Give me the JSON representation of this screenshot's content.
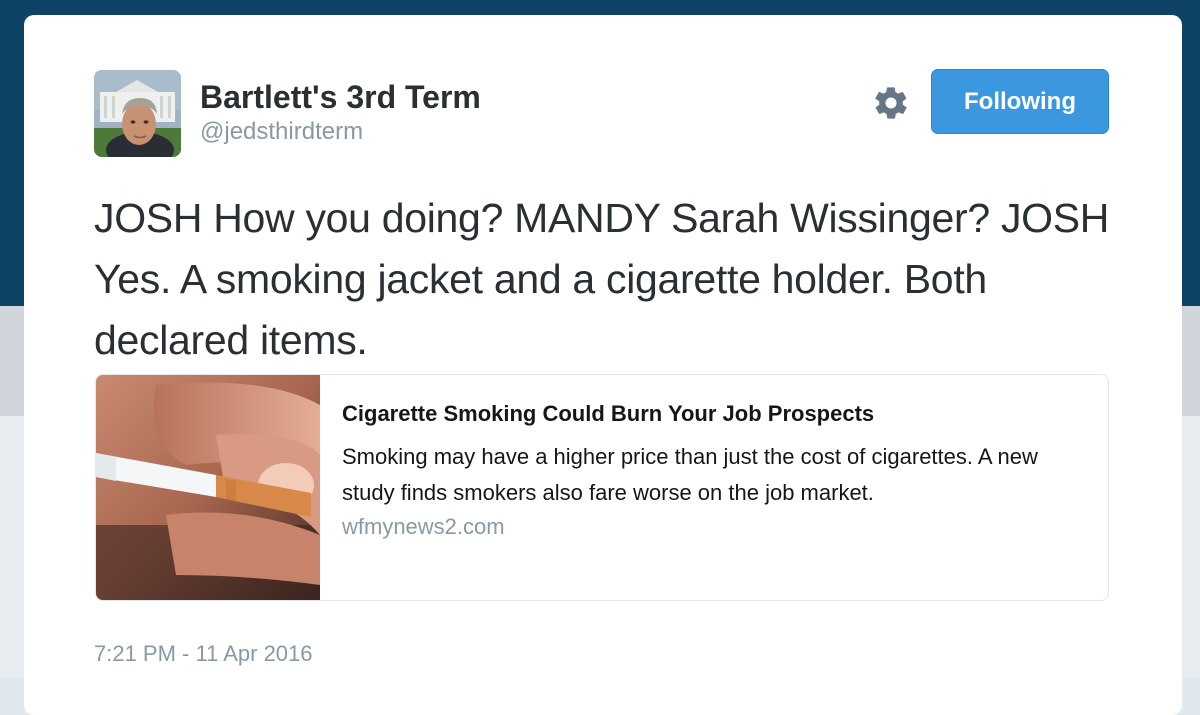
{
  "profile": {
    "display_name": "Bartlett's 3rd Term",
    "handle": "@jedsthirdterm",
    "avatar_icon": "profile-photo"
  },
  "actions": {
    "settings_icon": "gear-icon",
    "follow_label": "Following"
  },
  "tweet": {
    "text": "JOSH How you doing? MANDY Sarah Wissinger? JOSH Yes. A smoking jacket and a cigarette holder. Both declared items.",
    "timestamp": "7:21 PM - 11 Apr 2016"
  },
  "link_card": {
    "title": "Cigarette Smoking Could Burn Your Job Prospects",
    "description": "Smoking may have a higher price than just the cost of cigarettes. A new study finds smokers also fare worse on the job market.",
    "domain": "wfmynews2.com",
    "thumbnail_icon": "cigarette-photo"
  },
  "colors": {
    "accent_blue": "#3b98e0",
    "text_dark": "#292f33",
    "text_muted": "#8899a6",
    "header_bg": "#0e4366"
  }
}
